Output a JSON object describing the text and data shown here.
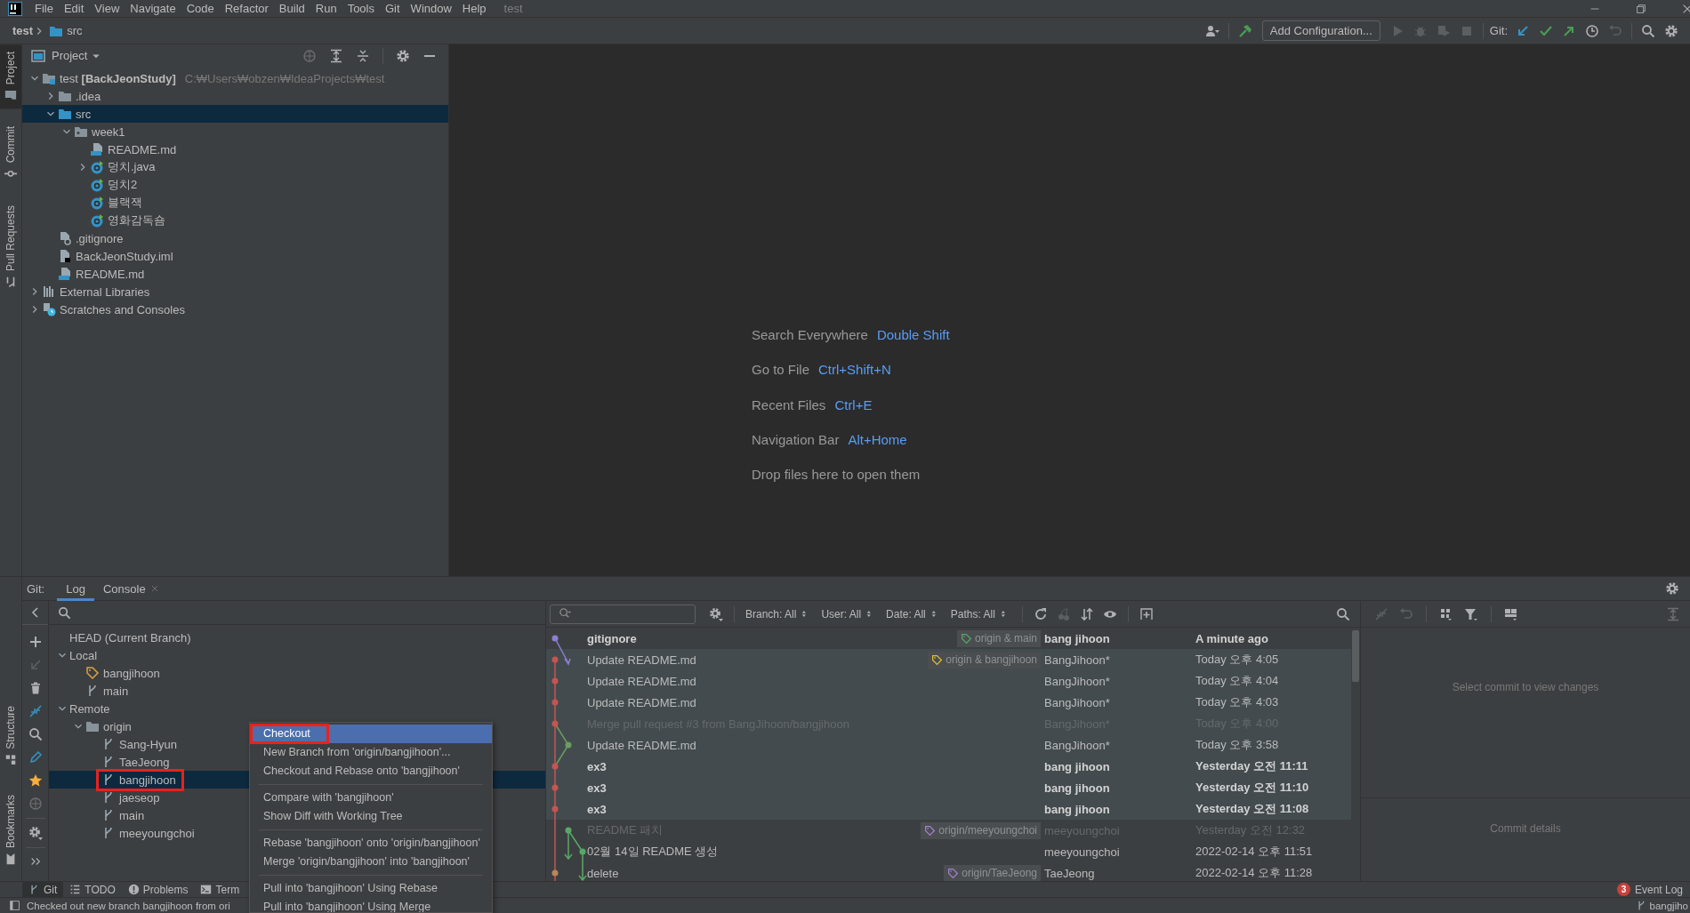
{
  "menu_bar": {
    "items": [
      "File",
      "Edit",
      "View",
      "Navigate",
      "Code",
      "Refactor",
      "Build",
      "Run",
      "Tools",
      "Git",
      "Window",
      "Help"
    ],
    "project_title": "test"
  },
  "breadcrumb": [
    "test",
    "src"
  ],
  "toolbar": {
    "run_config": "Add Configuration...",
    "git_label": "Git:"
  },
  "side_stripe": {
    "top": [
      {
        "label": "Project",
        "selected": true
      },
      {
        "label": "Commit",
        "selected": false
      },
      {
        "label": "Pull Requests",
        "selected": false
      }
    ],
    "bottom": [
      {
        "label": "Structure",
        "selected": false
      },
      {
        "label": "Bookmarks",
        "selected": false
      }
    ]
  },
  "project_panel": {
    "title": "Project",
    "tree": [
      {
        "label": "test **[BackJeonStudy]**",
        "path": "C:₩Users₩obzen₩IdeaProjects₩test",
        "kind": "module",
        "expanded": true,
        "selected": false,
        "children": [
          {
            "label": ".idea",
            "kind": "folder",
            "expanded": false,
            "selected": false
          },
          {
            "label": "src",
            "kind": "sources",
            "expanded": true,
            "selected": true,
            "children": [
              {
                "label": "week1",
                "kind": "package",
                "expanded": true,
                "selected": false,
                "children": [
                  {
                    "label": "README.md",
                    "kind": "markdown",
                    "selected": false
                  },
                  {
                    "label": "덩치.java",
                    "kind": "class",
                    "expanded": false,
                    "selected": false
                  },
                  {
                    "label": "덩치2",
                    "kind": "class",
                    "selected": false
                  },
                  {
                    "label": "블랙잭",
                    "kind": "class",
                    "selected": false
                  },
                  {
                    "label": "영화감독숌",
                    "kind": "class",
                    "selected": false
                  }
                ]
              }
            ]
          },
          {
            "label": ".gitignore",
            "kind": "gitignore",
            "selected": false
          },
          {
            "label": "BackJeonStudy.iml",
            "kind": "iml",
            "selected": false
          },
          {
            "label": "README.md",
            "kind": "markdown",
            "selected": false
          }
        ]
      },
      {
        "label": "External Libraries",
        "kind": "libraries",
        "expanded": false,
        "selected": false
      },
      {
        "label": "Scratches and Consoles",
        "kind": "scratches",
        "expanded": false,
        "selected": false
      }
    ]
  },
  "editor_hints": [
    {
      "label": "Search Everywhere",
      "shortcut": "Double Shift"
    },
    {
      "label": "Go to File",
      "shortcut": "Ctrl+Shift+N"
    },
    {
      "label": "Recent Files",
      "shortcut": "Ctrl+E"
    },
    {
      "label": "Navigation Bar",
      "shortcut": "Alt+Home"
    },
    {
      "label": "Drop files here to open them"
    }
  ],
  "git_panel": {
    "label": "Git:",
    "tabs": [
      {
        "label": "Log",
        "selected": true,
        "closable": false
      },
      {
        "label": "Console",
        "selected": false,
        "closable": true
      }
    ],
    "branches": [
      {
        "label": "HEAD (Current Branch)",
        "selected": false
      },
      {
        "label": "Local",
        "expanded": true,
        "selected": false,
        "children": [
          {
            "label": "bangjihoon",
            "kind": "current",
            "selected": false,
            "outlined": false
          },
          {
            "label": "main",
            "kind": "branch",
            "selected": false,
            "outlined": false
          }
        ]
      },
      {
        "label": "Remote",
        "expanded": true,
        "selected": false,
        "children": [
          {
            "label": "origin",
            "kind": "remote",
            "expanded": true,
            "selected": false,
            "children": [
              {
                "label": "Sang-Hyun",
                "kind": "branch",
                "selected": false,
                "outlined": false
              },
              {
                "label": "TaeJeong",
                "kind": "branch",
                "selected": false,
                "outlined": false
              },
              {
                "label": "bangjihoon",
                "kind": "branch",
                "selected": true,
                "outlined": true
              },
              {
                "label": "jaeseop",
                "kind": "branch",
                "selected": false,
                "outlined": false
              },
              {
                "label": "main",
                "kind": "branch",
                "selected": false,
                "outlined": false
              },
              {
                "label": "meeyoungchoi",
                "kind": "branch",
                "selected": false,
                "outlined": false
              }
            ]
          }
        ]
      }
    ],
    "filters": [
      "Branch: All",
      "User: All",
      "Date: All",
      "Paths: All"
    ],
    "commits": [
      {
        "message": "gitignore",
        "refs": [
          {
            "label": "origin & main",
            "color": "#59a869"
          }
        ],
        "author": "bang jihoon",
        "date": "A minute ago",
        "bold": true,
        "dimmed": false,
        "highlighted": false
      },
      {
        "message": "Update README.md",
        "refs": [
          {
            "label": "origin & bangjihoon",
            "color": "#e0c32e"
          }
        ],
        "author": "BangJihoon*",
        "date": "Today 오후 4:05",
        "bold": false,
        "dimmed": false,
        "highlighted": true
      },
      {
        "message": "Update README.md",
        "author": "BangJihoon*",
        "date": "Today 오후 4:04",
        "bold": false,
        "dimmed": false,
        "highlighted": true
      },
      {
        "message": "Update README.md",
        "author": "BangJihoon*",
        "date": "Today 오후 4:03",
        "bold": false,
        "dimmed": false,
        "highlighted": true
      },
      {
        "message": "Merge pull request #3 from BangJihoon/bangjihoon",
        "author": "BangJihoon*",
        "date": "Today 오후 4:00",
        "bold": false,
        "dimmed": true,
        "highlighted": true
      },
      {
        "message": "Update README.md",
        "author": "BangJihoon*",
        "date": "Today 오후 3:58",
        "bold": false,
        "dimmed": false,
        "highlighted": true
      },
      {
        "message": "ex3",
        "author": "bang jihoon",
        "date": "Yesterday 오전 11:11",
        "bold": true,
        "dimmed": false,
        "highlighted": true
      },
      {
        "message": "ex3",
        "author": "bang jihoon",
        "date": "Yesterday 오전 11:10",
        "bold": true,
        "dimmed": false,
        "highlighted": true
      },
      {
        "message": "ex3",
        "author": "bang jihoon",
        "date": "Yesterday 오전 11:08",
        "bold": true,
        "dimmed": false,
        "highlighted": true
      },
      {
        "message": "README 패치",
        "refs": [
          {
            "label": "origin/meeyoungchoi",
            "color": "#a77fcf"
          }
        ],
        "author": "meeyoungchoi",
        "date": "Yesterday 오전 12:32",
        "bold": false,
        "dimmed": true,
        "highlighted": false
      },
      {
        "message": "02월 14일 README 생성",
        "author": "meeyoungchoi",
        "date": "2022-02-14 오후 11:51",
        "bold": false,
        "dimmed": false,
        "highlighted": false
      },
      {
        "message": "delete",
        "refs": [
          {
            "label": "origin/TaeJeong",
            "color": "#a77fcf"
          }
        ],
        "author": "TaeJeong",
        "date": "2022-02-14 오후 11:28",
        "bold": false,
        "dimmed": false,
        "highlighted": false
      }
    ],
    "details": {
      "changes_placeholder": "Select commit to view changes",
      "details_placeholder": "Commit details"
    }
  },
  "context_menu": {
    "groups": [
      [
        {
          "label": "Checkout",
          "selected": true,
          "outlined": true
        },
        {
          "label": "New Branch from 'origin/bangjihoon'...",
          "selected": false,
          "outlined": false
        },
        {
          "label": "Checkout and Rebase onto 'bangjihoon'",
          "selected": false,
          "outlined": false
        }
      ],
      [
        {
          "label": "Compare with 'bangjihoon'",
          "selected": false,
          "outlined": false
        },
        {
          "label": "Show Diff with Working Tree",
          "selected": false,
          "outlined": false
        }
      ],
      [
        {
          "label": "Rebase 'bangjihoon' onto 'origin/bangjihoon'",
          "selected": false,
          "outlined": false
        },
        {
          "label": "Merge 'origin/bangjihoon' into 'bangjihoon'",
          "selected": false,
          "outlined": false
        }
      ],
      [
        {
          "label": "Pull into 'bangjihoon' Using Rebase",
          "selected": false,
          "outlined": false
        },
        {
          "label": "Pull into 'bangjihoon' Using Merge",
          "selected": false,
          "outlined": false
        }
      ]
    ]
  },
  "tool_tabs": [
    {
      "label": "Git",
      "selected": true
    },
    {
      "label": "TODO",
      "selected": false
    },
    {
      "label": "Problems",
      "selected": false
    },
    {
      "label": "Term",
      "selected": false
    }
  ],
  "event_log": {
    "label": "Event Log",
    "count": "3"
  },
  "status_bar": {
    "message": "Checked out new branch bangjihoon from ori",
    "branch": "bangjiho"
  }
}
